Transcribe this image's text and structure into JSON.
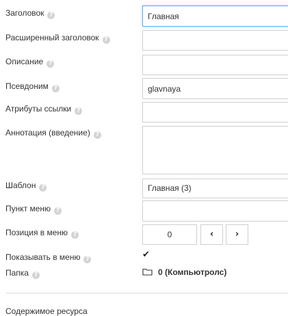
{
  "form": {
    "title": {
      "label": "Заголовок",
      "value": "Главная"
    },
    "long_title": {
      "label": "Расширенный заголовок",
      "value": ""
    },
    "description": {
      "label": "Описание",
      "value": ""
    },
    "alias": {
      "label": "Псевдоним",
      "value": "glavnaya"
    },
    "link_attributes": {
      "label": "Атрибуты ссылки",
      "value": ""
    },
    "introtext": {
      "label": "Аннотация (введение)",
      "value": ""
    },
    "template": {
      "label": "Шаблон",
      "value": "Главная (3)"
    },
    "menu_title": {
      "label": "Пункт меню",
      "value": ""
    },
    "menu_index": {
      "label": "Позиция в меню",
      "value": "0",
      "prev": "‹",
      "next": "›"
    },
    "show_in_menu": {
      "label": "Показывать в меню",
      "checked": true,
      "check_glyph": "✔"
    },
    "parent": {
      "label": "Папка",
      "icon": "folder-icon",
      "value": "0 (Компьютролс)"
    }
  },
  "content": {
    "label": "Содержимое ресурса"
  },
  "help_glyph": "?"
}
